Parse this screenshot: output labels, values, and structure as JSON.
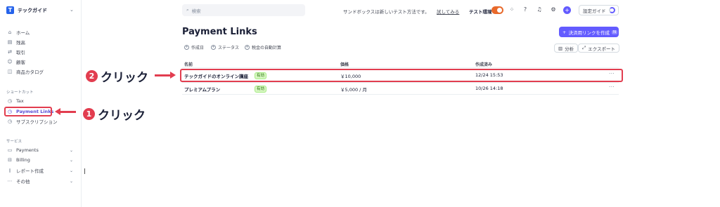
{
  "brand": {
    "name": "テックガイド",
    "logo_letter": "T"
  },
  "sidebar": {
    "items": [
      {
        "label": "ホーム",
        "icon": "home-icon"
      },
      {
        "label": "残高",
        "icon": "balance-icon"
      },
      {
        "label": "取引",
        "icon": "transactions-icon"
      },
      {
        "label": "顧客",
        "icon": "customer-icon"
      },
      {
        "label": "商品カタログ",
        "icon": "catalog-icon"
      }
    ],
    "shortcuts_title": "ショートカット",
    "shortcuts": [
      {
        "label": "Tax",
        "icon": "clock-icon"
      },
      {
        "label": "Payment Links",
        "icon": "clock-icon",
        "active": true
      },
      {
        "label": "サブスクリプション",
        "icon": "clock-icon"
      }
    ],
    "services_title": "サービス",
    "services": [
      {
        "label": "Payments",
        "icon": "payments-icon"
      },
      {
        "label": "Billing",
        "icon": "billing-icon"
      },
      {
        "label": "レポート作成",
        "icon": "report-icon"
      },
      {
        "label": "その他",
        "icon": "more-icon"
      }
    ]
  },
  "topbar": {
    "search_placeholder": "検索",
    "sandbox_note": "サンドボックスは新しいテスト方法です。",
    "try_link": "試してみる",
    "env_label": "テスト環境",
    "guide_label": "設定ガイド"
  },
  "page": {
    "title": "Payment Links",
    "create_button": "決済用リンクを作成",
    "create_shortcut": "N",
    "filters": [
      "作成日",
      "ステータス",
      "税金の自動計算"
    ],
    "analyze_button": "分析",
    "export_button": "エクスポート"
  },
  "table": {
    "headers": [
      "名前",
      "価格",
      "作成済み"
    ],
    "rows": [
      {
        "name": "テックガイドのオンライン講座",
        "status": "有効",
        "price": "￥10,000",
        "created": "12/24 15:53"
      },
      {
        "name": "プレミアムプラン",
        "status": "有効",
        "price": "￥5,000 / 月",
        "created": "10/26 14:18"
      }
    ]
  },
  "annotations": {
    "step1": {
      "number": "1",
      "text": "クリック"
    },
    "step2": {
      "number": "2",
      "text": "クリック"
    }
  },
  "colors": {
    "accent": "#635bff",
    "highlight": "#e23d4f",
    "toggle": "#e8692b",
    "badge_bg": "#d7f7c2"
  }
}
